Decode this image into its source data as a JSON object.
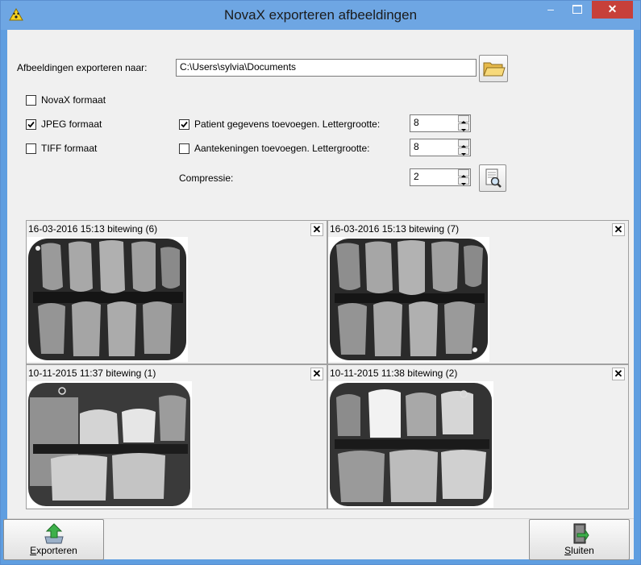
{
  "window": {
    "title": "NovaX exporteren afbeeldingen",
    "controls": {
      "minimize": "–",
      "close": "✕"
    }
  },
  "export": {
    "path_label": "Afbeeldingen exporteren naar:",
    "path_value": "C:\\Users\\sylvia\\Documents"
  },
  "formats": [
    {
      "label": "NovaX formaat",
      "checked": false
    },
    {
      "label": "JPEG formaat",
      "checked": true
    },
    {
      "label": "TIFF formaat",
      "checked": false
    }
  ],
  "options": {
    "patient": {
      "label": "Patient gegevens toevoegen. Lettergrootte:",
      "checked": true,
      "value": "8"
    },
    "annotations": {
      "label": "Aantekeningen toevoegen. Lettergrootte:",
      "checked": false,
      "value": "8"
    },
    "compression": {
      "label": "Compressie:",
      "value": "2"
    }
  },
  "images": [
    {
      "title": "16-03-2016 15:13 bitewing (6)",
      "close": "✕"
    },
    {
      "title": "16-03-2016 15:13 bitewing (7)",
      "close": "✕"
    },
    {
      "title": "10-11-2015 11:37 bitewing (1)",
      "close": "✕"
    },
    {
      "title": "10-11-2015 11:38 bitewing (2)",
      "close": "✕"
    }
  ],
  "buttons": {
    "export": {
      "label_hot": "E",
      "label_rest": "xporteren"
    },
    "close": {
      "label_hot": "S",
      "label_rest": "luiten"
    }
  },
  "icons": [
    "warning-icon",
    "folder-icon",
    "preview-icon",
    "export-icon",
    "exit-door-icon",
    "close-icon",
    "spin-up-icon",
    "spin-down-icon",
    "checkmark-icon"
  ]
}
